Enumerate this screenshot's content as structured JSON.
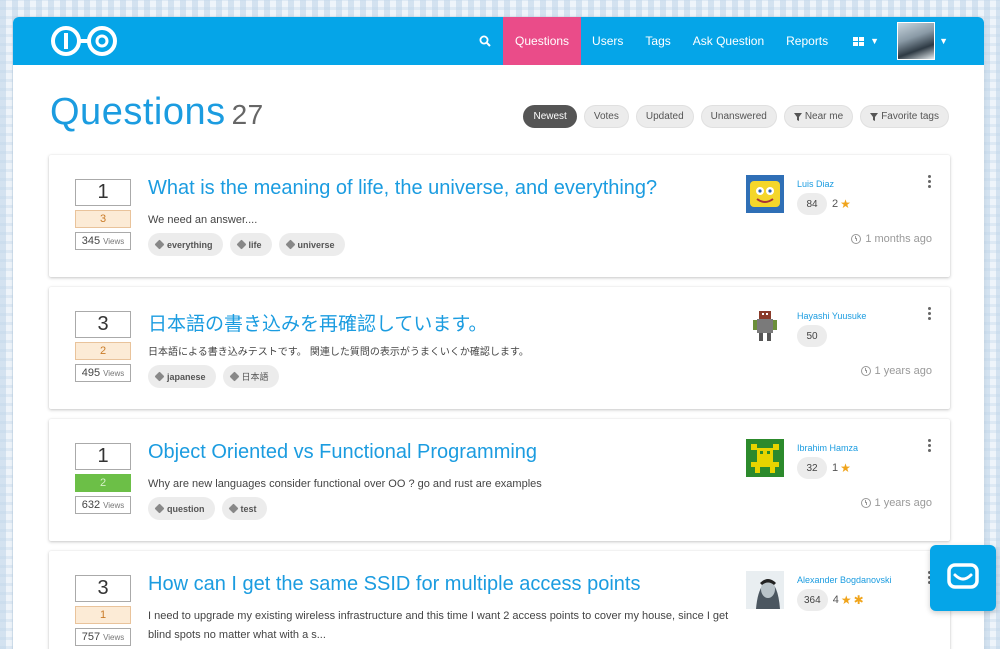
{
  "nav": {
    "search_icon": "search-icon",
    "links": [
      "Questions",
      "Users",
      "Tags",
      "Ask Question",
      "Reports"
    ],
    "active": "Questions",
    "accent": "#05a5e8",
    "active_color": "#ea4c89"
  },
  "header": {
    "title": "Questions",
    "count": "27",
    "filters": [
      "Newest",
      "Votes",
      "Updated",
      "Unanswered",
      "Near me",
      "Favorite tags"
    ],
    "active_filter": "Newest"
  },
  "questions": [
    {
      "votes": "1",
      "answers": "3",
      "views": "345",
      "views_label": "Views",
      "accepted": false,
      "title": "What is the meaning of life, the universe, and everything?",
      "excerpt": "We need an answer....",
      "tags": [
        "everything",
        "life",
        "universe"
      ],
      "user": "Luis Diaz",
      "rep": "84",
      "badges": "2",
      "stars": 1,
      "time": "1 months ago"
    },
    {
      "votes": "3",
      "answers": "2",
      "views": "495",
      "views_label": "Views",
      "accepted": false,
      "title": "日本語の書き込みを再確認しています。",
      "excerpt": "日本語による書き込みテストです。 関連した質問の表示がうまくいくか確認します。",
      "tags": [
        "japanese",
        "日本語"
      ],
      "user": "Hayashi Yuusuke",
      "rep": "50",
      "badges": "",
      "stars": 0,
      "time": "1 years ago"
    },
    {
      "votes": "1",
      "answers": "2",
      "views": "632",
      "views_label": "Views",
      "accepted": true,
      "title": "Object Oriented vs Functional Programming",
      "excerpt": "Why are new languages consider functional over OO ? go and rust are examples",
      "tags": [
        "question",
        "test"
      ],
      "user": "Ibrahim Hamza",
      "rep": "32",
      "badges": "1",
      "stars": 1,
      "time": "1 years ago"
    },
    {
      "votes": "3",
      "answers": "1",
      "views": "757",
      "views_label": "Views",
      "accepted": false,
      "title": "How can I get the same SSID for multiple access points",
      "excerpt": "I need to upgrade my existing wireless infrastructure and this time I want 2 access points to cover my house, since I get blind spots no matter what with a s...",
      "tags": [],
      "user": "Alexander Bogdanovski",
      "rep": "364",
      "badges": "4",
      "stars": 2,
      "time": ""
    }
  ]
}
